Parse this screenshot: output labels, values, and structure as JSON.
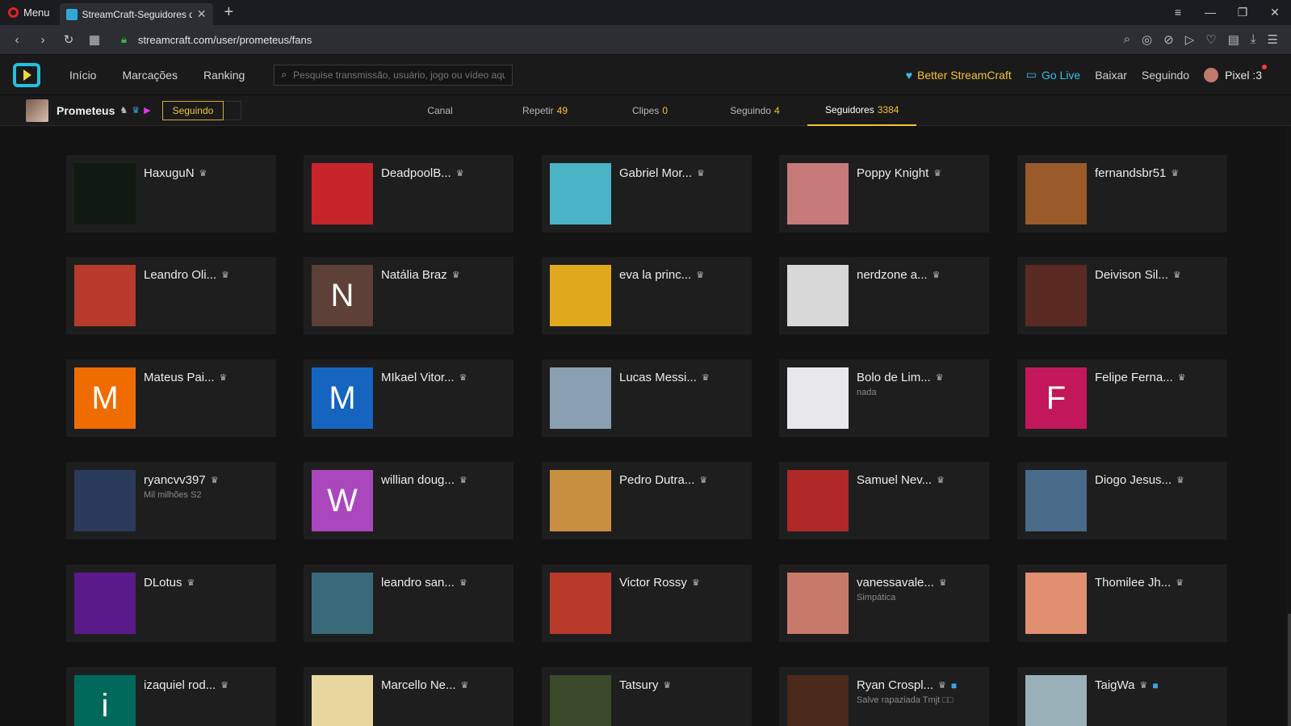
{
  "browser": {
    "menu_label": "Menu",
    "tab_title": "StreamCraft-Seguidores de",
    "url": "streamcraft.com/user/prometeus/fans"
  },
  "header": {
    "nav": [
      "Início",
      "Marcações",
      "Ranking"
    ],
    "search_placeholder": "Pesquise transmissão, usuário, jogo ou vídeo aqu",
    "better": "Better StreamCraft",
    "golive": "Go Live",
    "baixar": "Baixar",
    "seguindo": "Seguindo",
    "username": "Pixel :3"
  },
  "channel": {
    "name": "Prometeus",
    "follow_label": "Seguindo",
    "tabs": [
      {
        "label": "Canal",
        "count": ""
      },
      {
        "label": "Repetir",
        "count": "49"
      },
      {
        "label": "Clipes",
        "count": "0"
      },
      {
        "label": "Seguindo",
        "count": "4"
      },
      {
        "label": "Seguidores",
        "count": "3384"
      }
    ]
  },
  "followers": [
    {
      "name": "HaxuguN",
      "bio": "",
      "avatar_color": "#101a12",
      "avatar_letter": "",
      "cam": false
    },
    {
      "name": "DeadpoolB...",
      "bio": "",
      "avatar_color": "#c8242c",
      "avatar_letter": "",
      "cam": false
    },
    {
      "name": "Gabriel Mor...",
      "bio": "",
      "avatar_color": "#4ab3c6",
      "avatar_letter": "",
      "cam": false
    },
    {
      "name": "Poppy Knight",
      "bio": "",
      "avatar_color": "#c77a7a",
      "avatar_letter": "",
      "cam": false
    },
    {
      "name": "fernandsbr51",
      "bio": "",
      "avatar_color": "#9a5a2a",
      "avatar_letter": "",
      "cam": false
    },
    {
      "name": "Leandro Oli...",
      "bio": "",
      "avatar_color": "#b83a2a",
      "avatar_letter": "",
      "cam": false
    },
    {
      "name": "Natália Braz",
      "bio": "",
      "avatar_color": "#5d4037",
      "avatar_letter": "N",
      "cam": false
    },
    {
      "name": "eva la princ...",
      "bio": "",
      "avatar_color": "#e0a81c",
      "avatar_letter": "",
      "cam": false
    },
    {
      "name": "nerdzone a...",
      "bio": "",
      "avatar_color": "#d8d8d8",
      "avatar_letter": "",
      "cam": false
    },
    {
      "name": "Deivison Sil...",
      "bio": "",
      "avatar_color": "#5a2a22",
      "avatar_letter": "",
      "cam": false
    },
    {
      "name": "Mateus Pai...",
      "bio": "",
      "avatar_color": "#ef6c00",
      "avatar_letter": "M",
      "cam": false
    },
    {
      "name": "MIkael Vitor...",
      "bio": "",
      "avatar_color": "#1565c0",
      "avatar_letter": "M",
      "cam": false
    },
    {
      "name": "Lucas Messi...",
      "bio": "",
      "avatar_color": "#8aa0b0",
      "avatar_letter": "",
      "cam": false
    },
    {
      "name": "Bolo de Lim...",
      "bio": "nada",
      "avatar_color": "#e8e8ea",
      "avatar_letter": "",
      "cam": false
    },
    {
      "name": "Felipe Ferna...",
      "bio": "",
      "avatar_color": "#c2185b",
      "avatar_letter": "F",
      "cam": false
    },
    {
      "name": "ryancvv397",
      "bio": "Mil milhões S2",
      "avatar_color": "#2a3a5a",
      "avatar_letter": "",
      "cam": false
    },
    {
      "name": "willian doug...",
      "bio": "",
      "avatar_color": "#ab47bc",
      "avatar_letter": "W",
      "cam": false
    },
    {
      "name": "Pedro Dutra...",
      "bio": "",
      "avatar_color": "#c89040",
      "avatar_letter": "",
      "cam": false
    },
    {
      "name": "Samuel Nev...",
      "bio": "",
      "avatar_color": "#b02828",
      "avatar_letter": "",
      "cam": false
    },
    {
      "name": "Diogo Jesus...",
      "bio": "",
      "avatar_color": "#4a6a8a",
      "avatar_letter": "",
      "cam": false
    },
    {
      "name": "DLotus",
      "bio": "",
      "avatar_color": "#5a1a8a",
      "avatar_letter": "",
      "cam": false
    },
    {
      "name": "leandro san...",
      "bio": "",
      "avatar_color": "#3a6a7a",
      "avatar_letter": "",
      "cam": false
    },
    {
      "name": "Victor Rossy",
      "bio": "",
      "avatar_color": "#b83a2a",
      "avatar_letter": "",
      "cam": false
    },
    {
      "name": "vanessavale...",
      "bio": "Simpática",
      "avatar_color": "#c87a6a",
      "avatar_letter": "",
      "cam": false
    },
    {
      "name": "Thomilee Jh...",
      "bio": "",
      "avatar_color": "#e09070",
      "avatar_letter": "",
      "cam": false
    },
    {
      "name": "izaquiel rod...",
      "bio": "",
      "avatar_color": "#00695c",
      "avatar_letter": "i",
      "cam": false
    },
    {
      "name": "Marcello Ne...",
      "bio": "",
      "avatar_color": "#e8d8a0",
      "avatar_letter": "",
      "cam": false
    },
    {
      "name": "Tatsury",
      "bio": "",
      "avatar_color": "#3a4a2a",
      "avatar_letter": "",
      "cam": false
    },
    {
      "name": "Ryan Crospl...",
      "bio": "Salve rapaziada Tmjt □□",
      "avatar_color": "#4a2a1a",
      "avatar_letter": "",
      "cam": true
    },
    {
      "name": "TaigWa",
      "bio": "",
      "avatar_color": "#9ab0b8",
      "avatar_letter": "",
      "cam": true
    }
  ]
}
